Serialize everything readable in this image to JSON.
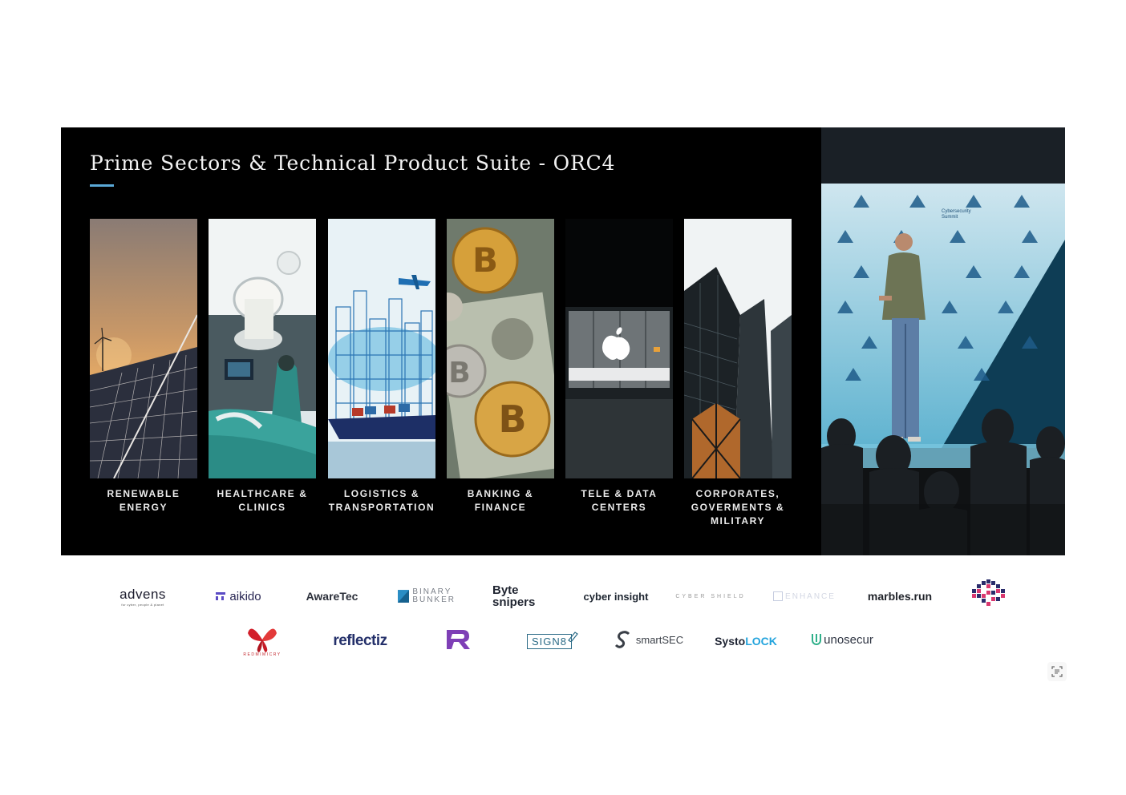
{
  "slide": {
    "title": "Prime Sectors & Technical Product Suite - ORC4",
    "accent_color": "#5aa8d6",
    "sectors": [
      {
        "lines": [
          "RENEWABLE",
          "ENERGY"
        ],
        "image": "solar-panels-wind-turbine"
      },
      {
        "lines": [
          "HEALTHCARE &",
          "CLINICS"
        ],
        "image": "operating-room"
      },
      {
        "lines": [
          "LOGISTICS &",
          "TRANSPORTATION"
        ],
        "image": "city-plane-cargo-ship"
      },
      {
        "lines": [
          "BANKING &",
          "FINANCE"
        ],
        "image": "bitcoin-coins-dollar-bills"
      },
      {
        "lines": [
          "TELE & DATA",
          "CENTERS"
        ],
        "image": "apple-store-building"
      },
      {
        "lines": [
          "CORPORATES,",
          "GOVERMENTS &",
          "MILITARY"
        ],
        "image": "skyscrapers"
      }
    ]
  },
  "camera": {
    "backdrop_text": [
      "Cybersecurity",
      "Summit"
    ],
    "image": "speaker-on-stage"
  },
  "sponsors": {
    "row1": [
      {
        "name": "advens",
        "text": "advens",
        "sub": "for cyber, people & planet"
      },
      {
        "name": "aikido",
        "text": "aikido"
      },
      {
        "name": "awaretec",
        "text": "AwareTec"
      },
      {
        "name": "binary-bunker",
        "text": "BINARY",
        "text2": "BUNKER"
      },
      {
        "name": "bytesnipers",
        "text": "Byte",
        "text2": "snipers"
      },
      {
        "name": "cyber-insight",
        "text": "cyber insight"
      },
      {
        "name": "cyber-shield",
        "text": "CYBER SHIELD"
      },
      {
        "name": "sc-guard",
        "text": "ENHANCE"
      },
      {
        "name": "marbles-run",
        "text": "marbles.run"
      },
      {
        "name": "pixel-brain",
        "text": ""
      }
    ],
    "row2": [
      {
        "name": "redmimicry",
        "text": "REDMIMICRY"
      },
      {
        "name": "reflectiz",
        "text": "reflectiz"
      },
      {
        "name": "r-logo",
        "text": ""
      },
      {
        "name": "sign8",
        "text": "SIGN8"
      },
      {
        "name": "smartsec",
        "text": "smartSEC"
      },
      {
        "name": "systolock",
        "text": "Systo",
        "text2": "LOCK"
      },
      {
        "name": "unosecur",
        "text": "unosecur"
      }
    ]
  }
}
